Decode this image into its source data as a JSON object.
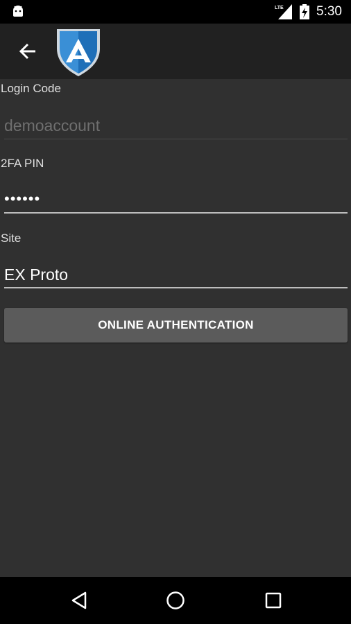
{
  "status_bar": {
    "network_label": "LTE",
    "time": "5:30",
    "icons": [
      "android-icon",
      "signal-icon",
      "battery-charging-icon"
    ]
  },
  "toolbar": {
    "back_icon": "arrow-left-icon",
    "logo_letter": "A",
    "colors": {
      "shield_blue": "#3a8fd6",
      "shield_dark": "#1b5e9e"
    }
  },
  "form": {
    "login_code": {
      "label": "Login Code",
      "placeholder": "demoaccount",
      "value": ""
    },
    "pin": {
      "label": "2FA PIN",
      "value": "••••••"
    },
    "site": {
      "label": "Site",
      "value": "EX Proto"
    },
    "submit_label": "ONLINE AUTHENTICATION"
  },
  "nav_bar": {
    "buttons": [
      "back-triangle-icon",
      "home-circle-icon",
      "recents-square-icon"
    ]
  }
}
